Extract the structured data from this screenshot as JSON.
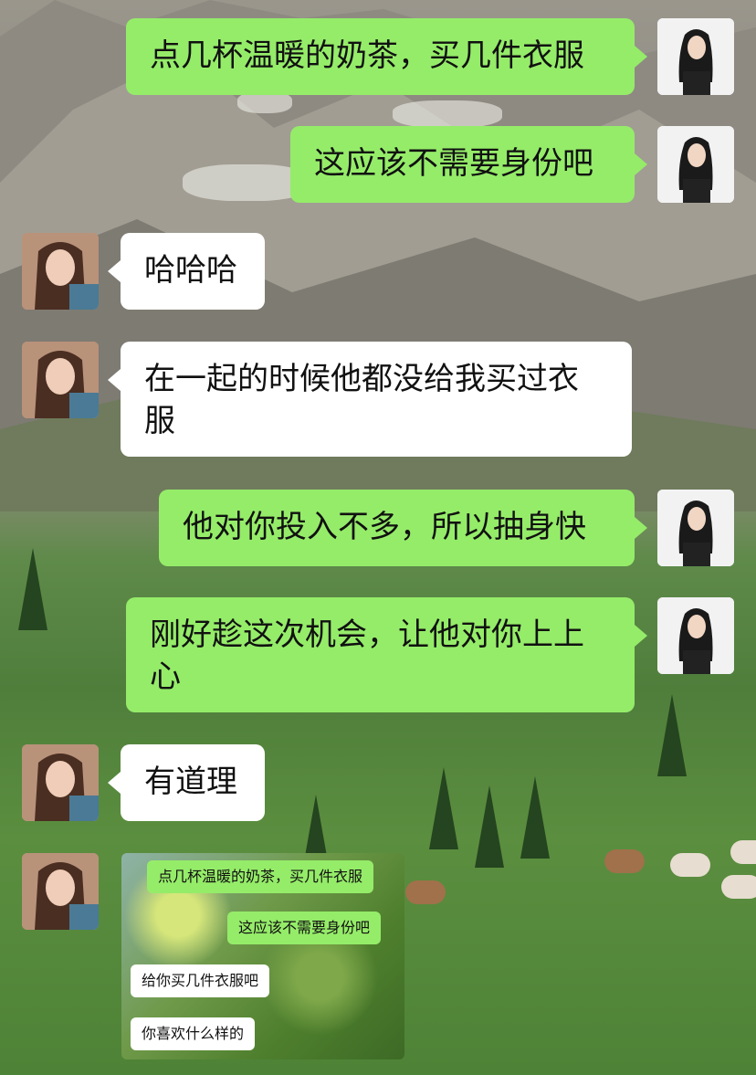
{
  "messages": [
    {
      "from": "me",
      "text": "点几杯温暖的奶茶，买几件衣服"
    },
    {
      "from": "me",
      "text": "这应该不需要身份吧"
    },
    {
      "from": "them",
      "text": "哈哈哈"
    },
    {
      "from": "them",
      "text": "在一起的时候他都没给我买过衣服"
    },
    {
      "from": "me",
      "text": "他对你投入不多，所以抽身快"
    },
    {
      "from": "me",
      "text": "刚好趁这次机会，让他对你上上心"
    },
    {
      "from": "them",
      "text": "有道理"
    }
  ],
  "image_message": {
    "lines": [
      {
        "from": "me",
        "text": "点几杯温暖的奶茶，买几件衣服"
      },
      {
        "from": "me",
        "text": "这应该不需要身份吧"
      },
      {
        "from": "them",
        "text": "给你买几件衣服吧"
      },
      {
        "from": "them",
        "text": "你喜欢什么样的"
      }
    ]
  },
  "colors": {
    "my_bubble": "#95ec69",
    "their_bubble": "#ffffff"
  }
}
